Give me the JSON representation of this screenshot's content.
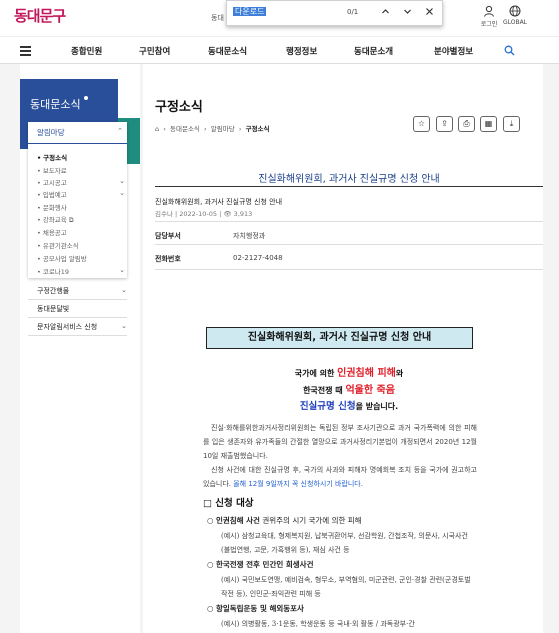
{
  "header": {
    "logo": "동대문구",
    "partial_text": "동대",
    "find": {
      "query": "다운로드",
      "count": "0/1"
    },
    "login_label": "로그인",
    "global_label": "GLOBAL"
  },
  "gnb": {
    "items": [
      "종합민원",
      "구민참여",
      "동대문소식",
      "행정정보",
      "동대문소개",
      "분야별정보"
    ]
  },
  "sidebar": {
    "title": "동대문소식",
    "group_label": "알림마당",
    "sub_items": [
      "구정소식",
      "보도자료",
      "고시공고",
      "입법예고",
      "문화행사",
      "강좌교육",
      "채용공고",
      "유관기관소식",
      "공모사업 알림방",
      "코로나19"
    ],
    "top_items": [
      "구정간행물",
      "동대문달빛",
      "문자알림서비스 신청"
    ]
  },
  "content": {
    "page_title": "구정소식",
    "breadcrumb": [
      "동대문소식",
      "알림마당",
      "구정소식"
    ],
    "post_title": "진실화해위원회, 과거사 진실규명 신청 안내",
    "meta_title": "진실화해위원회, 과거사 진실규명 신청 안내",
    "meta_info": "김수나  |  2022-10-05  |  👁 3,913",
    "dept_label": "담당부서",
    "dept_value": "자치행정과",
    "phone_label": "전화번호",
    "phone_value": "02-2127-4048"
  },
  "doc": {
    "box_title": "진실화해위원회, 과거사 진실규명 신청 안내",
    "line1_a": "국가에 의한 ",
    "line1_red": "인권침해 피해",
    "line1_b": "와",
    "line2_a": "한국전쟁 때 ",
    "line2_red": "억울한 죽음",
    "line3_blue": "진실규명 신청",
    "line3_b": "을 받습니다.",
    "para1": "진실·화해를위한과거사정리위원회는 독립된 정부 조사기관으로 과거 국가폭력에 의한 피해를 입은 생존자와 유가족들의 간절한 열망으로 과거사정리기본법이 개정되면서 2020년 12월 10일 재출범했습니다.",
    "para2_a": "신청 사건에 대한 진실규명 후, 국가의 사과와 피해자 명예회복 조치 등을 국가에 권고하고 있습니다. ",
    "para2_hl": "올해 12월 9일까지 꼭 신청하시기 바랍니다.",
    "section_head": "□ 신청 대상",
    "cat1_head": "인권침해 사건",
    "cat1_tail": " 권위주의 시기 국가에 의한 피해",
    "cat1_ex": "(예시) 삼청교육대, 형제복지원, 납북귀환어부, 선감학원, 간첩조작, 의문사, 시국사건(불법연행, 고문, 가혹행위 등), 재심 사건 등",
    "cat2_head": "한국전쟁 전후 민간인 희생사건",
    "cat2_ex": "(예시) 국민보도연맹, 예비검속, 형무소, 부역혐의, 미군관련, 군인·경찰 관련(군경토벌작전 등), 인민군·좌익관련 피해 등",
    "cat3_head": "항일독립운동 및 해외동포사",
    "cat3_ex": "(예시) 의병활동, 3·1운동, 학생운동 등 국내·외 활동 / 과독광부·간"
  }
}
